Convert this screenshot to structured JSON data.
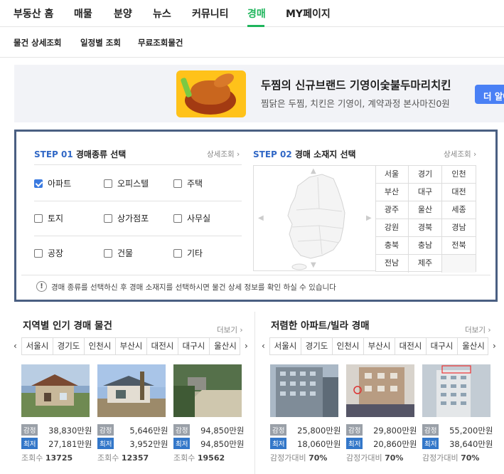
{
  "topnav": {
    "items": [
      "부동산 홈",
      "매물",
      "분양",
      "뉴스",
      "커뮤니티",
      "경매",
      "MY페이지"
    ],
    "active": "경매",
    "accent": "#1fb55c"
  },
  "subnav": {
    "items": [
      "물건 상세조회",
      "일정별 조회",
      "무료조회물건"
    ]
  },
  "banner": {
    "title": "두찜의 신규브랜드 기영이숯불두마리치킨",
    "desc": "찜닭은 두찜, 치킨은 기영이, 계약과정 본사마진0원",
    "button": "더 알아"
  },
  "step1": {
    "num": "STEP 01",
    "title": "경매종류 선택",
    "more": "상세조회",
    "types": [
      {
        "label": "아파트",
        "checked": true
      },
      {
        "label": "오피스텔",
        "checked": false
      },
      {
        "label": "주택",
        "checked": false
      },
      {
        "label": "토지",
        "checked": false
      },
      {
        "label": "상가점포",
        "checked": false
      },
      {
        "label": "사무실",
        "checked": false
      },
      {
        "label": "공장",
        "checked": false
      },
      {
        "label": "건물",
        "checked": false
      },
      {
        "label": "기타",
        "checked": false
      }
    ]
  },
  "step2": {
    "num": "STEP 02",
    "title": "경매 소재지 선택",
    "more": "상세조회",
    "regions": [
      "서울",
      "경기",
      "인천",
      "부산",
      "대구",
      "대전",
      "광주",
      "울산",
      "세종",
      "강원",
      "경북",
      "경남",
      "충북",
      "충남",
      "전북",
      "전남",
      "제주",
      ""
    ]
  },
  "notice": "경매 종류를 선택하신 후 경매 소재지를 선택하시면 물건 상세 정보를 확인 하실 수 있습니다",
  "popular": {
    "title": "지역별 인기 경매 물건",
    "more": "더보기",
    "tabs": [
      "서울시",
      "경기도",
      "인천시",
      "부산시",
      "대전시",
      "대구시",
      "울산시"
    ],
    "items": [
      {
        "gamjeong": "38,830만원",
        "choejeo": "27,181만원",
        "views_label": "조회수",
        "views": "13725"
      },
      {
        "gamjeong": "5,646만원",
        "choejeo": "3,952만원",
        "views_label": "조회수",
        "views": "12357"
      },
      {
        "gamjeong": "94,850만원",
        "choejeo": "94,850만원",
        "views_label": "조회수",
        "views": "19562"
      }
    ]
  },
  "cheap": {
    "title": "저렴한 아파트/빌라 경매",
    "more": "더보기",
    "tabs": [
      "서울시",
      "경기도",
      "인천시",
      "부산시",
      "대전시",
      "대구시",
      "울산시"
    ],
    "items": [
      {
        "gamjeong": "25,800만원",
        "choejeo": "18,060만원",
        "ratio_label": "감정가대비",
        "ratio": "70%"
      },
      {
        "gamjeong": "29,800만원",
        "choejeo": "20,860만원",
        "ratio_label": "감정가대비",
        "ratio": "70%"
      },
      {
        "gamjeong": "55,200만원",
        "choejeo": "38,640만원",
        "ratio_label": "감정가대비",
        "ratio": "70%"
      }
    ]
  },
  "labels": {
    "gamjeong": "감정",
    "choejeo": "최저"
  }
}
